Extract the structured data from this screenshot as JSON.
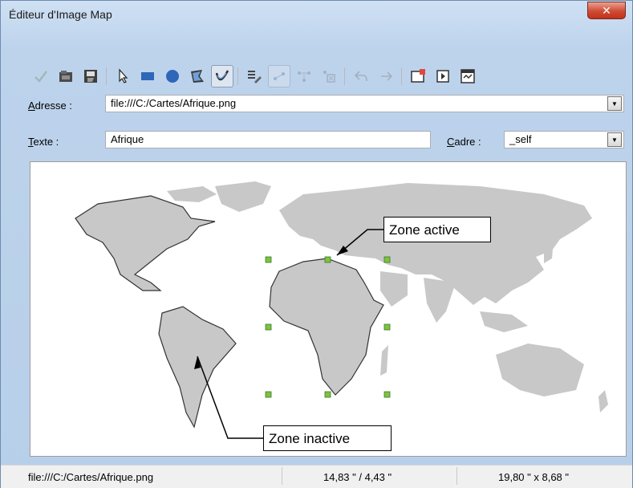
{
  "window": {
    "title": "Éditeur d'Image Map",
    "close_icon": "x-close-icon"
  },
  "toolbar": {
    "groups": [
      [
        "apply-icon",
        "open-icon",
        "save-icon"
      ],
      [
        "select-pointer-icon",
        "rectangle-icon",
        "ellipse-icon",
        "polygon-icon",
        "freeform-polygon-icon"
      ],
      [
        "edit-points-icon",
        "move-points-icon",
        "insert-points-icon",
        "delete-points-icon"
      ],
      [
        "undo-icon",
        "redo-icon"
      ],
      [
        "active-icon",
        "macro-icon",
        "properties-icon"
      ]
    ]
  },
  "address": {
    "label_underlined": "A",
    "label_rest": "dresse :",
    "value": "file:///C:/Cartes/Afrique.png"
  },
  "text": {
    "label_underlined": "T",
    "label_rest": "exte :",
    "value": "Afrique"
  },
  "frame": {
    "label_underlined": "C",
    "label_rest": "adre :",
    "value": "_self"
  },
  "annotations": {
    "active": "Zone active",
    "inactive": "Zone inactive"
  },
  "status": {
    "file": "file:///C:/Cartes/Afrique.png",
    "position": "14,83 \" / 4,43 \"",
    "size": "19,80 \" x 8,68 \""
  },
  "colors": {
    "land": "#c8c8c8",
    "handle": "#7dc242",
    "titlebar": "#bdd3ec",
    "close_button": "#cf4b34"
  }
}
